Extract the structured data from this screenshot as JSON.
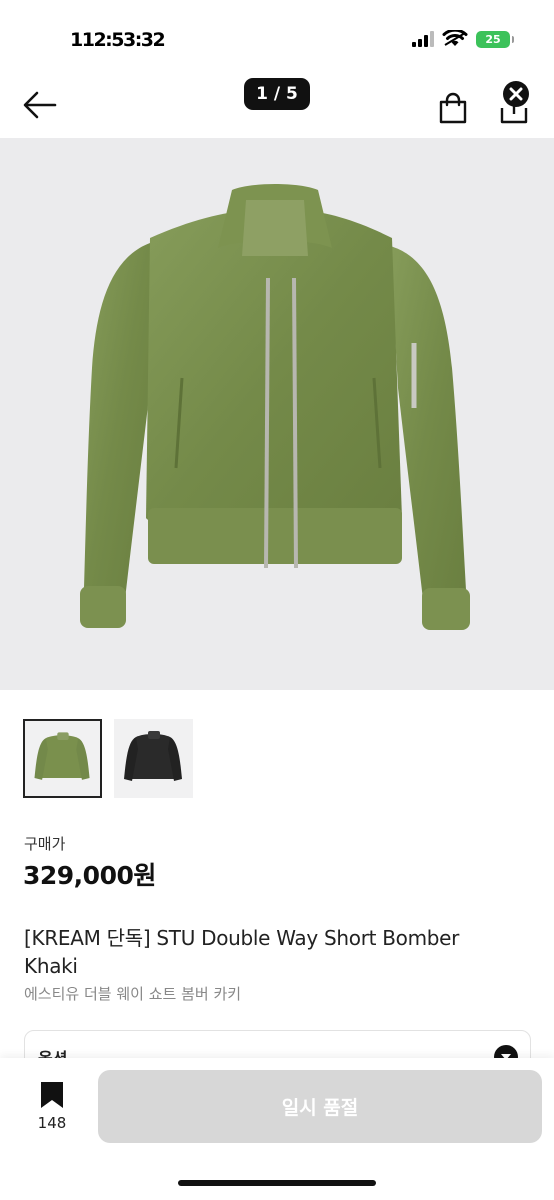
{
  "status_bar": {
    "time": "112:53:32",
    "battery": "25"
  },
  "header": {
    "page_counter": "1 / 5",
    "back_icon": "arrow-left-icon",
    "bag_icon": "shopping-bag-icon",
    "share_icon": "share-icon",
    "close_icon": "close-icon"
  },
  "product": {
    "main_image": "khaki bomber jacket",
    "thumbnails": [
      {
        "name": "khaki bomber",
        "active": true
      },
      {
        "name": "black bomber",
        "active": false
      }
    ],
    "price_label": "구매가",
    "price": "329,000원",
    "title_en": "[KREAM 단독] STU Double Way Short Bomber Khaki",
    "title_kr": "에스티유 더블 웨이 쇼트 봄버 카키"
  },
  "option": {
    "label": "옵션"
  },
  "bottom_bar": {
    "bookmark_count": "148",
    "soldout_label": "일시 품절"
  },
  "colors": {
    "accent": "#111111",
    "battery": "#3cc25a",
    "soldout_bg": "#d7d7d7",
    "jacket_khaki": "#7d9451"
  }
}
